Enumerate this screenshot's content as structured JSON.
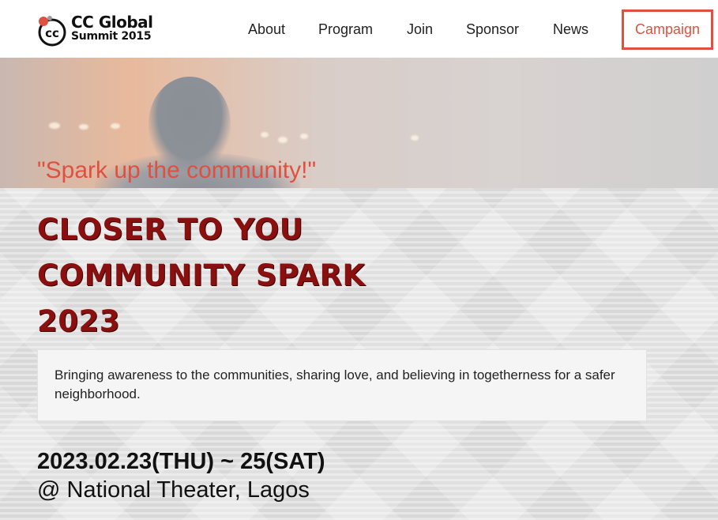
{
  "header": {
    "logo": {
      "line1": "CC Global",
      "line2": "Summit 2015",
      "mark": "cc",
      "accent_color": "#e05040"
    },
    "nav": {
      "about": "About",
      "program": "Program",
      "join": "Join",
      "sponsor": "Sponsor",
      "news": "News"
    },
    "campaign_label": "Campaign",
    "campaign_color": "#e05040"
  },
  "hero": {
    "tagline": "\"Spark up the community!\"",
    "headline": {
      "line1": "CLOSER TO YOU",
      "line2": "COMMUNITY SPARK",
      "line3": "2023"
    },
    "headline_color": "#8a1010",
    "description": "Bringing awareness to the communities, sharing love, and believing in togetherness for a safer neighborhood.",
    "date": "2023.02.23(THU) ~ 25(SAT)",
    "venue": "@ National Theater, Lagos"
  }
}
